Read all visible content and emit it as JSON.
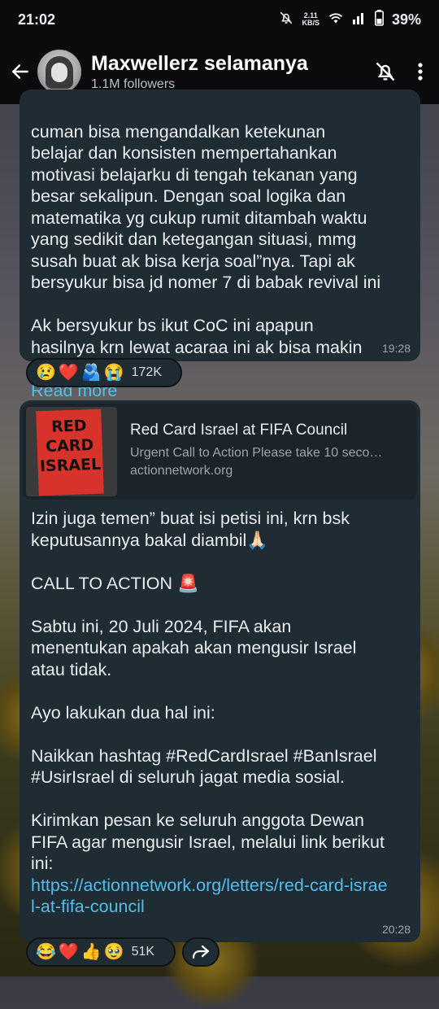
{
  "status": {
    "time": "21:02",
    "kbs_top": "2.11",
    "kbs_bottom": "KB/S",
    "battery": "39%"
  },
  "header": {
    "title": "Maxwellerz selamanya",
    "subtitle": "1.1M followers"
  },
  "messages": [
    {
      "text": "cuman bisa mengandalkan ketekunan\nbelajar dan konsisten mempertahankan\nmotivasi belajarku di tengah tekanan yang\nbesar sekalipun. Dengan soal logika dan\nmatematika yg cukup rumit ditambah waktu\nyang sedikit dan ketegangan situasi, mmg\nsusah buat ak bisa kerja soal”nya. Tapi ak\nbersyukur bisa jd nomer 7 di babak revival ini\n\nAk bersyukur bs ikut CoC ini apapun\nhasilnya krn lewat acaraa ini ak bisa makin\ntermotiva...",
      "read_more": "Read more",
      "time": "19:28",
      "reactions": {
        "emojis": [
          "😢",
          "❤️",
          "🫂",
          "😭"
        ],
        "count": "172K"
      }
    },
    {
      "preview": {
        "image_text": "RED CARD ISRAEL",
        "title": "Red Card Israel at FIFA Council",
        "description": "Urgent Call to Action  Please take 10 seco…",
        "domain": "actionnetwork.org"
      },
      "text": "Izin juga temen”  buat isi petisi ini, krn bsk\nkeputusannya bakal diambil🙏🏻\n\nCALL TO ACTION 🚨\n\nSabtu ini, 20 Juli 2024, FIFA akan\nmenentukan apakah akan mengusir Israel\natau tidak.\n\nAyo lakukan dua hal ini:\n\nNaikkan hashtag #RedCardIsrael #BanIsrael\n#UsirIsrael di seluruh jagat media sosial.\n\nKirimkan pesan ke seluruh anggota Dewan\nFIFA agar mengusir Israel, melalui link berikut\nini:",
      "link": "https://actionnetwork.org/letters/red-card-israel-at-fifa-council",
      "time": "20:28",
      "reactions": {
        "emojis": [
          "😂",
          "❤️",
          "👍",
          "🥹"
        ],
        "count": "51K"
      }
    }
  ],
  "icons": [
    "back-arrow-icon",
    "mute-bell-icon",
    "more-vert-icon",
    "forward-icon",
    "wifi-icon",
    "signal-icon",
    "battery-icon",
    "dnd-bell-icon"
  ]
}
